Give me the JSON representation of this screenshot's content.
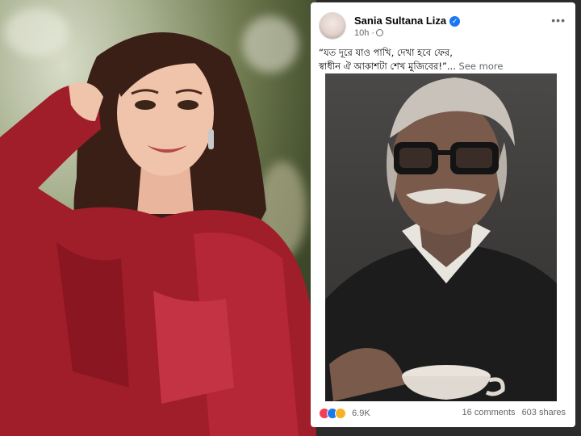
{
  "post": {
    "author": "Sania Sultana Liza",
    "time": "10h",
    "text_line1": "“যত দূরে যাও পাখি, দেখা হবে ফের,",
    "text_line2": "স্বাধীন ঐ আকাশটা শেখ মুজিবের!”...",
    "see_more": "See more",
    "reaction_count": "6.9K",
    "comments": "16 comments",
    "shares": "603 shares"
  },
  "icons": {
    "more": "more-horizontal-icon",
    "verified": "verified-badge-icon",
    "audience": "globe-icon",
    "reactions": [
      "love-icon",
      "like-icon",
      "haha-icon"
    ]
  },
  "colors": {
    "fb_blue": "#1877f2",
    "muted_text": "#65676b",
    "dress_red": "#a01d2a"
  }
}
